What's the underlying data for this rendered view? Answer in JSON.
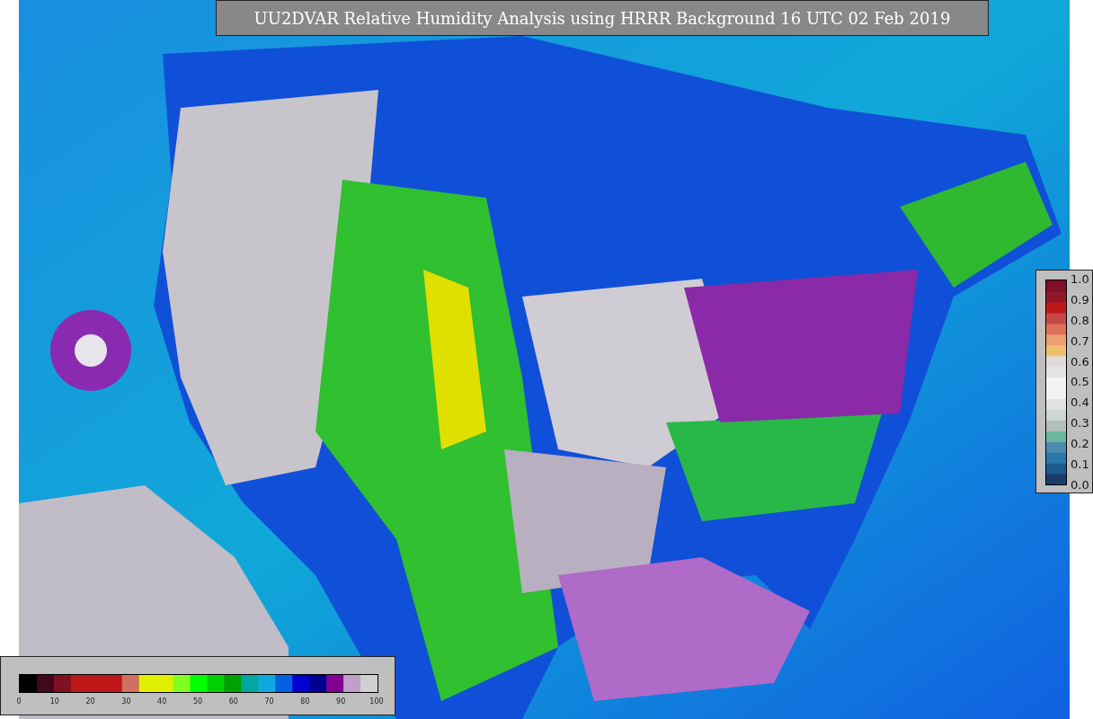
{
  "title": "UU2DVAR Relative Humidity Analysis using HRRR Background 16 UTC 02 Feb 2019",
  "observation_legend": {
    "labels": [
      "1.0",
      "0.9",
      "0.8",
      "0.7",
      "0.6",
      "0.5",
      "0.4",
      "0.3",
      "0.2",
      "0.1",
      "0.0"
    ]
  },
  "humidity_colorbar": {
    "labels": [
      "0",
      "10",
      "20",
      "30",
      "40",
      "50",
      "60",
      "70",
      "80",
      "90",
      "100"
    ]
  }
}
